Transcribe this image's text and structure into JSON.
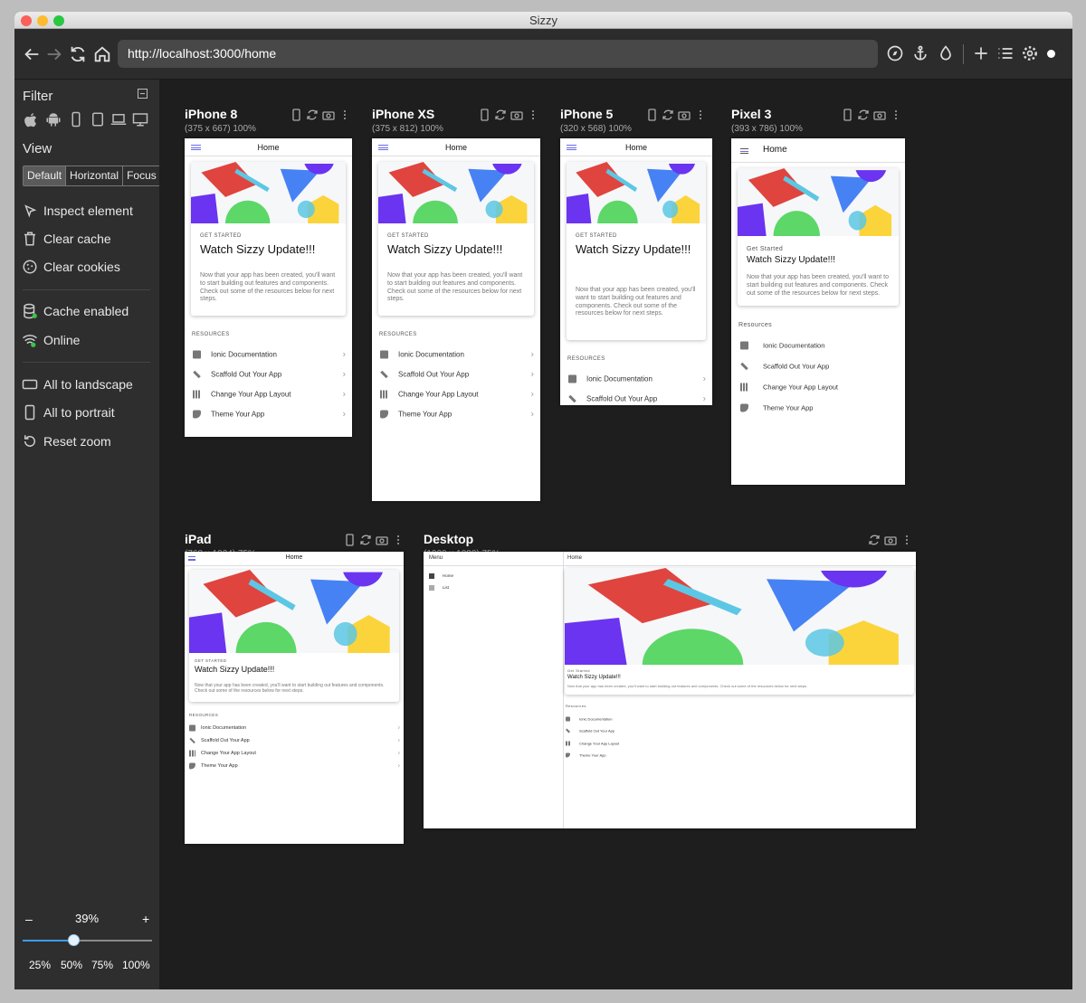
{
  "window": {
    "title": "Sizzy"
  },
  "address": {
    "url": "http://localhost:3000/home"
  },
  "sidebar": {
    "filter_label": "Filter",
    "filter_icons": [
      "apple-icon",
      "android-icon",
      "phone-icon",
      "tablet-icon",
      "laptop-icon",
      "desktop-icon"
    ],
    "view_label": "View",
    "view_tabs": [
      "Default",
      "Horizontal",
      "Focus"
    ],
    "view_selected": "Default",
    "tools": [
      "Inspect element",
      "Clear cache",
      "Clear cookies"
    ],
    "toggles": [
      "Cache enabled",
      "Online"
    ],
    "actions": [
      "All to landscape",
      "All to portrait",
      "Reset zoom"
    ],
    "zoom": {
      "minus": "–",
      "plus": "+",
      "value": "39%",
      "level": 0.39,
      "presets": [
        "25%",
        "50%",
        "75%",
        "100%"
      ]
    }
  },
  "devices": [
    {
      "name": "iPhone 8",
      "size": "(375 x 667) 100%"
    },
    {
      "name": "iPhone XS",
      "size": "(375 x 812) 100%"
    },
    {
      "name": "iPhone 5",
      "size": "(320 x 568) 100%"
    },
    {
      "name": "Pixel 3",
      "size": "(393 x 786) 100%"
    },
    {
      "name": "iPad",
      "size": "(768 x 1024) 75%"
    },
    {
      "name": "Desktop",
      "size": "(1920 x 1080) 75%"
    }
  ],
  "app": {
    "page_title": "Home",
    "kicker": "GET STARTED",
    "kicker_md": "Get Started",
    "card_title": "Watch Sizzy Update!!!",
    "card_body": "Now that your app has been created, you'll want to start building out features and components. Check out some of the resources below for next steps.",
    "resources_label": "RESOURCES",
    "resources_label_md": "Resources",
    "resources": [
      "Ionic Documentation",
      "Scaffold Out Your App",
      "Change Your App Layout",
      "Theme Your App"
    ],
    "menu_title": "Menu",
    "menu_items": [
      "Home",
      "List"
    ]
  },
  "colors": {
    "accent": "#3880ff",
    "hamburger": "#6a6ae8",
    "red": "#e0443e",
    "blue": "#3d7bf3",
    "purple": "#6a34f0",
    "green": "#5cd768",
    "yellow": "#fbd43b",
    "cyan": "#5cc7e4"
  }
}
